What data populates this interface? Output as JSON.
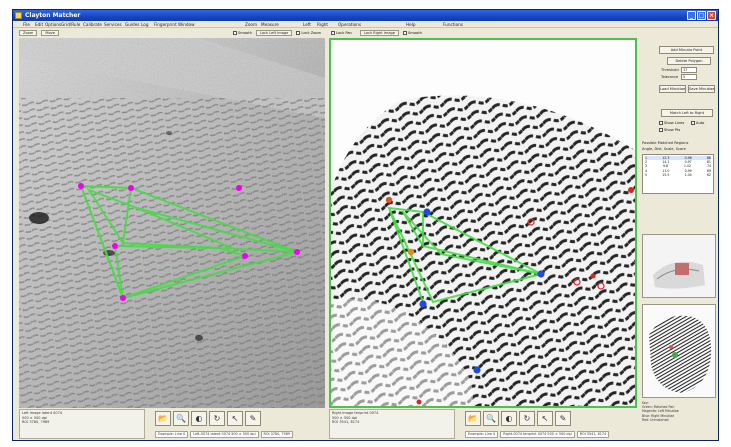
{
  "window": {
    "title": "Clayton Matcher",
    "controls": {
      "minimize": "_",
      "maximize": "□",
      "close": "×"
    }
  },
  "menu": [
    {
      "id": "file",
      "label": "File"
    },
    {
      "id": "edit",
      "label": "Edit"
    },
    {
      "id": "options",
      "label": "Options"
    },
    {
      "id": "grid",
      "label": "Grid/Rule"
    },
    {
      "id": "calibrate",
      "label": "Calibrate"
    },
    {
      "id": "services",
      "label": "Services"
    },
    {
      "id": "guides",
      "label": "Guides"
    },
    {
      "id": "log",
      "label": "Log"
    },
    {
      "id": "fingerprint",
      "label": "Fingerprint"
    },
    {
      "id": "window",
      "label": "Window"
    },
    {
      "id": "zoom",
      "label": "Zoom"
    },
    {
      "id": "measure",
      "label": "Measure"
    },
    {
      "id": "left",
      "label": "Left"
    },
    {
      "id": "right",
      "label": "Right"
    },
    {
      "id": "operations",
      "label": "Operations"
    },
    {
      "id": "help",
      "label": "Help"
    },
    {
      "id": "functions",
      "label": "Functions"
    }
  ],
  "left_toolbar": {
    "zoom_button": "Zoom",
    "move_button": "Move",
    "smooth_check": "Smooth",
    "lock_button": "Lock Left Image",
    "lock_check": "Lock Zoom"
  },
  "right_toolbar": {
    "pan_check": "Lock Pan",
    "lock_button": "Lock Right Image",
    "smooth_check": "Smooth"
  },
  "left_pane": {
    "image_icon": "latent-fingerprint-image",
    "points_color": "#ee00ee",
    "overlay_color": "#44dd44"
  },
  "right_pane": {
    "image_icon": "rolled-fingerprint-image",
    "border_color": "#4cc14c",
    "overlay_color": "#44dd44"
  },
  "left_info": {
    "line1": "Left Image   latent 0074",
    "line2": "500 × 500 dpi",
    "line3": "ROI 3780, 7989"
  },
  "right_info": {
    "line1": "Right Image   tenprint 0074",
    "line2": "500 × 500 dpi",
    "line3": "ROI 3541, 8174"
  },
  "left_icons": [
    {
      "name": "open-image-icon",
      "glyph": "📂"
    },
    {
      "name": "magnify-icon",
      "glyph": "🔍"
    },
    {
      "name": "contrast-icon",
      "glyph": "◐"
    },
    {
      "name": "rotate-icon",
      "glyph": "↻"
    },
    {
      "name": "pointer-icon",
      "glyph": "↖"
    },
    {
      "name": "pen-icon",
      "glyph": "✎"
    }
  ],
  "right_icons": [
    {
      "name": "open-image-icon",
      "glyph": "📂"
    },
    {
      "name": "magnify-icon",
      "glyph": "🔍"
    },
    {
      "name": "contrast-icon",
      "glyph": "◐"
    },
    {
      "name": "rotate-icon",
      "glyph": "↻"
    },
    {
      "name": "pointer-icon",
      "glyph": "↖"
    },
    {
      "name": "pen-icon",
      "glyph": "✎"
    }
  ],
  "left_status": [
    "Example: Line 0",
    "Left-0074 latent 0074 500 × 500 dpi",
    "ROI 3780, 7989"
  ],
  "right_status": [
    "Example: Line 0",
    "Right-0074 tenprint 0074 500 × 500 dpi",
    "ROI 3541, 8174"
  ],
  "sidebar": {
    "add_minutia_button": "Add Minutia Point",
    "delete_polygon_button": "Delete Polygon",
    "threshold_label": "Threshold",
    "threshold_value": "17",
    "tolerance_label": "Tolerance",
    "tolerance_value": "5",
    "load_button": "Load Minutiae",
    "save_button": "Save Minutiae",
    "match_button": "Match Left to Right",
    "overlay_check": "Show Lines",
    "auto_check": "Auto",
    "show_pts_check": "Show Pts",
    "results_title": "Possible Matched Regions",
    "results_subtitle": "Angle, Dist, Scale, Score",
    "results": [
      {
        "n": "1",
        "a": "12.3",
        "b": "0.98",
        "c": "88"
      },
      {
        "n": "2",
        "a": "14.1",
        "b": "0.97",
        "c": "81"
      },
      {
        "n": "3",
        "a": "9.8",
        "b": "1.02",
        "c": "74"
      },
      {
        "n": "4",
        "a": "11.0",
        "b": "0.99",
        "c": "69"
      },
      {
        "n": "5",
        "a": "15.5",
        "b": "1.04",
        "c": "62"
      }
    ],
    "legend": [
      "Key:",
      "Green: Matched Pair",
      "Magenta: Left Minutiae",
      "Blue: Right Minutiae",
      "Red: Unmatched"
    ]
  }
}
